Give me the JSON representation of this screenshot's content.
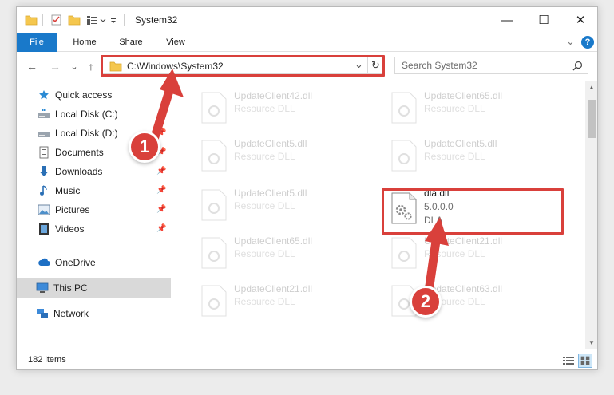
{
  "window": {
    "title": "System32",
    "minimize_glyph": "—",
    "maximize_glyph": "☐",
    "close_glyph": "✕"
  },
  "ribbon": {
    "tabs": [
      "File",
      "Home",
      "Share",
      "View"
    ],
    "expand_glyph": "⌄",
    "help_glyph": "?"
  },
  "nav": {
    "back_glyph": "←",
    "forward_glyph": "→",
    "recent_glyph": "⌄",
    "up_glyph": "↑",
    "address": "C:\\Windows\\System32",
    "dropdown_glyph": "⌄",
    "refresh_glyph": "↻",
    "search_placeholder": "Search System32"
  },
  "sidebar": {
    "items": [
      {
        "label": "Quick access",
        "icon": "star-icon",
        "pinned": false
      },
      {
        "label": "Local Disk (C:)",
        "icon": "drive-icon",
        "pinned": true
      },
      {
        "label": "Local Disk (D:)",
        "icon": "drive-icon",
        "pinned": true
      },
      {
        "label": "Documents",
        "icon": "documents-icon",
        "pinned": true
      },
      {
        "label": "Downloads",
        "icon": "download-icon",
        "pinned": true
      },
      {
        "label": "Music",
        "icon": "music-icon",
        "pinned": true
      },
      {
        "label": "Pictures",
        "icon": "pictures-icon",
        "pinned": true
      },
      {
        "label": "Videos",
        "icon": "videos-icon",
        "pinned": true
      },
      {
        "label": "OneDrive",
        "icon": "cloud-icon",
        "pinned": false
      },
      {
        "label": "This PC",
        "icon": "computer-icon",
        "pinned": false
      },
      {
        "label": "Network",
        "icon": "network-icon",
        "pinned": false
      }
    ]
  },
  "files": [
    {
      "name": "UpdateClient42.dll",
      "type": "Resource DLL"
    },
    {
      "name": "UpdateClient65.dll",
      "type": "Resource DLL"
    },
    {
      "name": "UpdateClient5.dll",
      "type": "Resource DLL"
    },
    {
      "name": "UpdateClient5.dll",
      "type": "Resource DLL"
    },
    {
      "name": "UpdateClient5.dll",
      "type": "Resource DLL"
    },
    {
      "name": "dla.dll",
      "version": "5.0.0.0",
      "type": "DLA"
    },
    {
      "name": "UpdateClient65.dll",
      "type": "Resource DLL"
    },
    {
      "name": "UpdateClient21.dll",
      "type": "Resource DLL"
    },
    {
      "name": "UpdateClient21.dll",
      "type": "Resource DLL"
    },
    {
      "name": "UpdateClient63.dll",
      "type": "Resource DLL"
    }
  ],
  "status": {
    "item_count": "182 items"
  },
  "annotations": {
    "step1": "1",
    "step2": "2",
    "accent_color": "#d9403b"
  },
  "colors": {
    "file_tab": "#1979ca",
    "selected_row": "#d9d9d9"
  }
}
